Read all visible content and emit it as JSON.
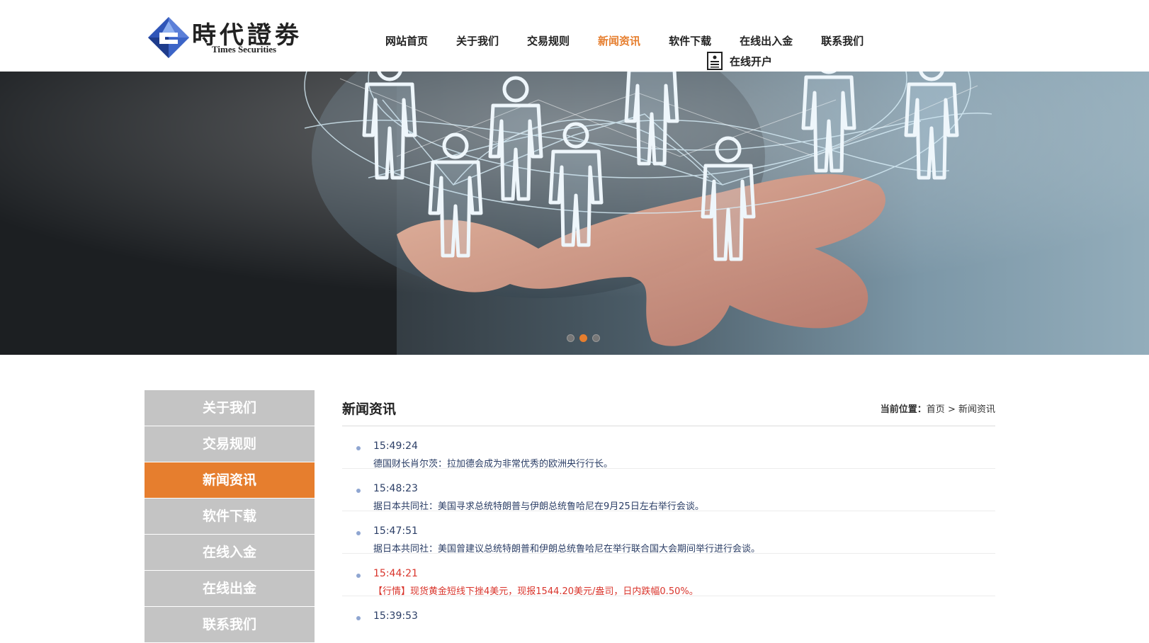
{
  "brand": {
    "name_cn": "時代證劵",
    "name_en": "Times Securities",
    "colors": {
      "primary_blue": "#2f55b8",
      "accent_orange": "#e67e2e"
    }
  },
  "nav": {
    "items": [
      {
        "label": "网站首页"
      },
      {
        "label": "关于我们"
      },
      {
        "label": "交易规则"
      },
      {
        "label": "新闻资讯",
        "active": true
      },
      {
        "label": "软件下载"
      },
      {
        "label": "在线出入金"
      },
      {
        "label": "联系我们"
      }
    ],
    "open_account": {
      "label": "在线开户",
      "icon": "document-icon"
    }
  },
  "banner": {
    "slides": 3,
    "active_slide": 2
  },
  "sidebar": {
    "items": [
      {
        "label": "关于我们"
      },
      {
        "label": "交易规则"
      },
      {
        "label": "新闻资讯",
        "active": true
      },
      {
        "label": "软件下载"
      },
      {
        "label": "在线入金"
      },
      {
        "label": "在线出金"
      },
      {
        "label": "联系我们"
      }
    ]
  },
  "main": {
    "title": "新闻资讯",
    "breadcrumb": {
      "label": "当前位置：",
      "home": "首页",
      "separator": " > ",
      "current": "新闻资讯"
    },
    "news": [
      {
        "time": "15:49:24",
        "text": "德国财长肖尔茨：拉加德会成为非常优秀的欧洲央行行长。",
        "highlight": false
      },
      {
        "time": "15:48:23",
        "text": "据日本共同社：美国寻求总统特朗普与伊朗总统鲁哈尼在9月25日左右举行会谈。",
        "highlight": false
      },
      {
        "time": "15:47:51",
        "text": "据日本共同社：美国曾建议总统特朗普和伊朗总统鲁哈尼在举行联合国大会期间举行进行会谈。",
        "highlight": false
      },
      {
        "time": "15:44:21",
        "text": "【行情】现货黄金短线下挫4美元，现报1544.20美元/盎司，日内跌幅0.50%。",
        "highlight": true
      },
      {
        "time": "15:39:53",
        "text": "",
        "highlight": false
      }
    ]
  }
}
